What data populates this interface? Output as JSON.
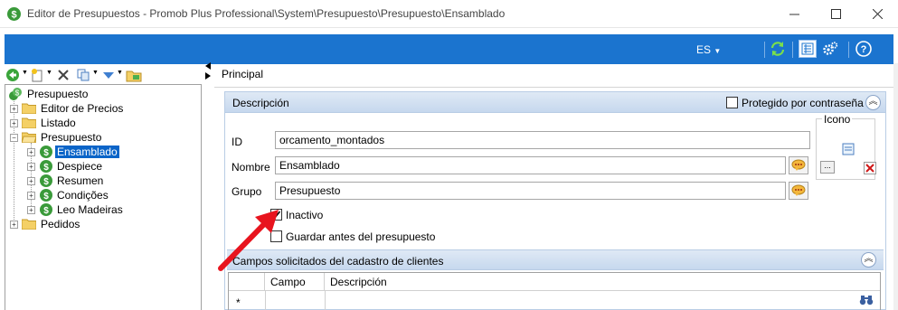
{
  "window": {
    "title": "Editor de Presupuestos - Promob Plus Professional\\System\\Presupuesto\\Presupuesto\\Ensamblado",
    "minimize_icon": "minimize-icon",
    "maximize_icon": "maximize-icon",
    "close_icon": "close-icon"
  },
  "toolbar": {
    "language": "ES",
    "icons": [
      "refresh-icon",
      "properties-icon",
      "settings-icon",
      "help-icon"
    ]
  },
  "tree_toolbar": {
    "icons": [
      "back-icon",
      "new-icon",
      "delete-icon",
      "copy-icon",
      "move-down-icon",
      "import-icon"
    ]
  },
  "tree": {
    "root": "Presupuesto",
    "items": [
      {
        "label": "Editor de Precios"
      },
      {
        "label": "Listado"
      },
      {
        "label": "Presupuesto"
      },
      {
        "label": "Ensamblado"
      },
      {
        "label": "Despiece"
      },
      {
        "label": "Resumen"
      },
      {
        "label": "Condições"
      },
      {
        "label": "Leo Madeiras"
      },
      {
        "label": "Pedidos"
      }
    ]
  },
  "tab": {
    "title": "Principal"
  },
  "description_panel": {
    "title": "Descripción",
    "protected_label": "Protegido por contraseña",
    "protected_checked": false,
    "icon_group_label": "Icono",
    "icon_browse_label": "...",
    "fields": {
      "id_label": "ID",
      "id_value": "orcamento_montados",
      "name_label": "Nombre",
      "name_value": "Ensamblado",
      "group_label": "Grupo",
      "group_value": "Presupuesto"
    },
    "inactive_label": "Inactivo",
    "inactive_checked": true,
    "save_before_label": "Guardar antes del presupuesto",
    "save_before_checked": false
  },
  "customer_fields_panel": {
    "title": "Campos solicitados del cadastro de clientes",
    "columns": [
      "Campo",
      "Descripción"
    ],
    "new_row_marker": "*"
  },
  "colors": {
    "accent": "#1b74cf",
    "selection": "#0a64c8",
    "annotation_arrow": "#e8141e"
  }
}
